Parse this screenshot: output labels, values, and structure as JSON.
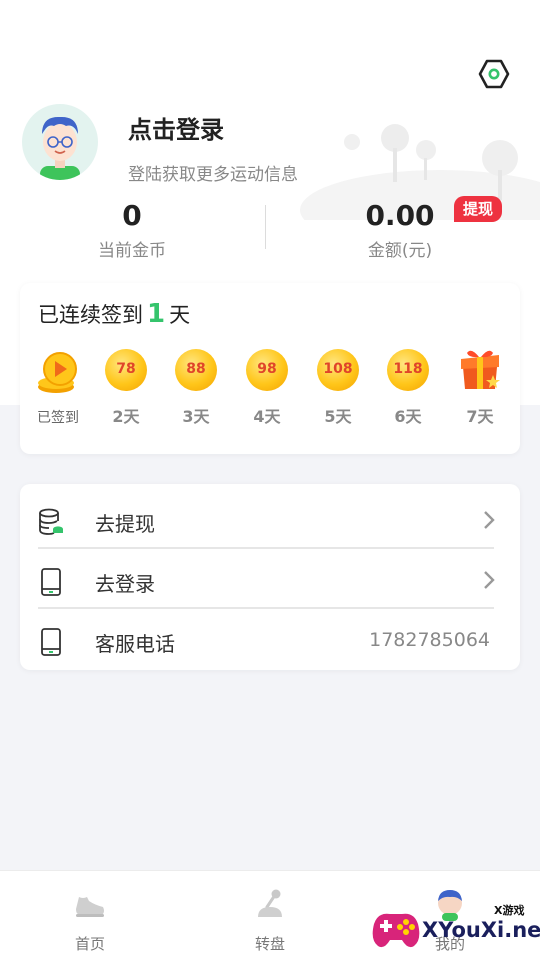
{
  "header": {
    "settings_icon": "gear-icon",
    "login_title": "点击登录",
    "login_subtitle": "登陆获取更多运动信息"
  },
  "stats": {
    "coins_value": "0",
    "coins_label": "当前金币",
    "money_value": "0.00",
    "money_label": "金额(元)",
    "withdraw_badge": "提现"
  },
  "signin": {
    "prefix": "已连续签到",
    "count": "1",
    "suffix": "天",
    "days": [
      {
        "coin": "",
        "label": "已签到",
        "state": "done"
      },
      {
        "coin": "78",
        "label": "2天",
        "state": "pending"
      },
      {
        "coin": "88",
        "label": "3天",
        "state": "pending"
      },
      {
        "coin": "98",
        "label": "4天",
        "state": "pending"
      },
      {
        "coin": "108",
        "label": "5天",
        "state": "pending"
      },
      {
        "coin": "118",
        "label": "6天",
        "state": "pending"
      },
      {
        "coin": "",
        "label": "7天",
        "state": "gift"
      }
    ]
  },
  "menu": {
    "items": [
      {
        "label": "去提现",
        "icon": "database-coin-icon",
        "value": ""
      },
      {
        "label": "去登录",
        "icon": "phone-icon",
        "value": ""
      },
      {
        "label": "客服电话",
        "icon": "phone-icon",
        "value": "1782785064"
      }
    ]
  },
  "tabbar": {
    "tabs": [
      {
        "label": "首页",
        "icon": "shoe-icon"
      },
      {
        "label": "转盘",
        "icon": "joystick-icon"
      },
      {
        "label": "我的",
        "icon": "avatar-icon"
      }
    ]
  },
  "watermark": {
    "text": "XYouXi.net",
    "small": "X游戏"
  },
  "colors": {
    "accent_green": "#35c46c",
    "badge_red": "#ee3240",
    "coin_gold": "#ffc61a",
    "background": "#f3f4f8"
  }
}
